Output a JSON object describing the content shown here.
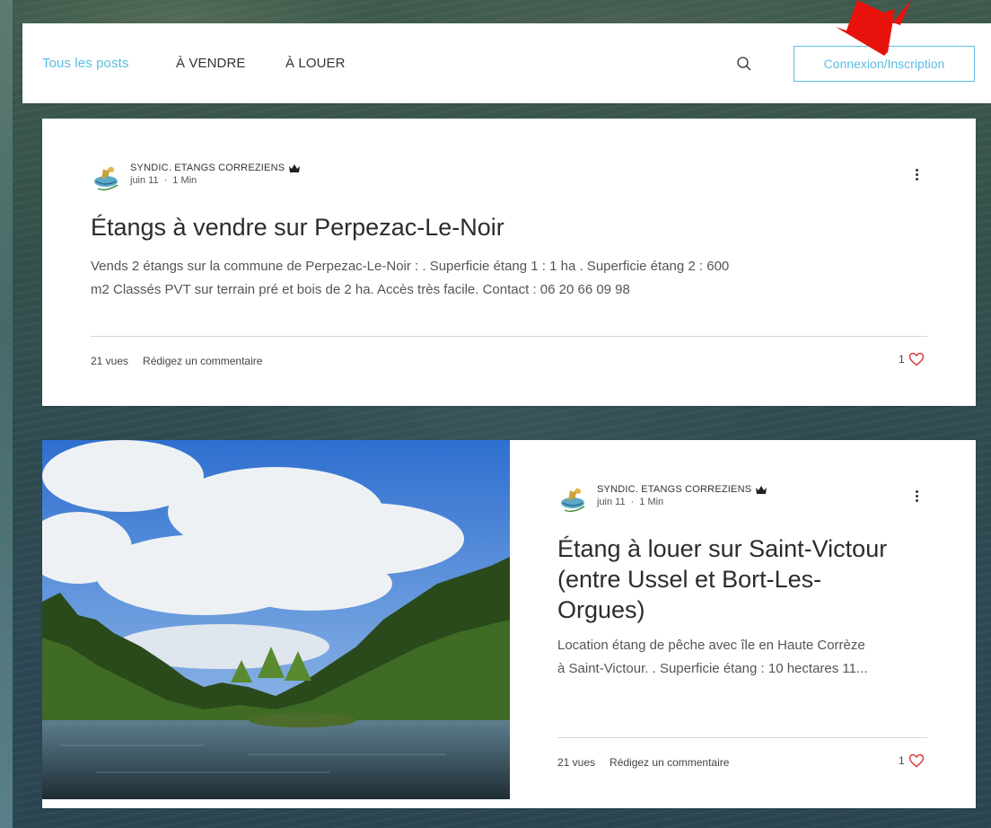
{
  "nav": {
    "items": [
      {
        "label": "Tous les posts",
        "active": true
      },
      {
        "label": "À VENDRE",
        "active": false
      },
      {
        "label": "À LOUER",
        "active": false
      }
    ],
    "login_label": "Connexion/Inscription",
    "accent_color": "#5bbde3"
  },
  "posts": [
    {
      "author": "SYNDIC. ETANGS CORREZIENS",
      "date": "juin 11",
      "read_time": "1 Min",
      "title": "Étangs à vendre sur Perpezac-Le-Noir",
      "excerpt_line1": "Vends 2 étangs sur la commune de Perpezac-Le-Noir : . Superficie étang 1 : 1 ha . Superficie étang 2 : 600",
      "excerpt_line2": "m2 Classés PVT sur terrain pré et bois de 2 ha. Accès très facile. Contact : 06 20 66 09 98",
      "views": "21 vues",
      "comment_label": "Rédigez un commentaire",
      "likes": "1"
    },
    {
      "author": "SYNDIC. ETANGS CORREZIENS",
      "date": "juin 11",
      "read_time": "1 Min",
      "title_line1": "Étang à louer sur Saint-Victour",
      "title_line2": "(entre Ussel et Bort-Les-",
      "title_line3": "Orgues)",
      "excerpt_line1": "Location étang de pêche avec île en Haute Corrèze",
      "excerpt_line2": "à Saint-Victour. . Superficie étang : 10 hectares 11...",
      "views": "21 vues",
      "comment_label": "Rédigez un commentaire",
      "likes": "1"
    }
  ],
  "icons": {
    "search": "search-icon",
    "more": "more-vertical-icon",
    "heart": "heart-icon",
    "crown": "crown-icon",
    "arrow": "red-arrow-annotation"
  },
  "colors": {
    "heart": "#e23b3b",
    "arrow": "#e8120c"
  }
}
